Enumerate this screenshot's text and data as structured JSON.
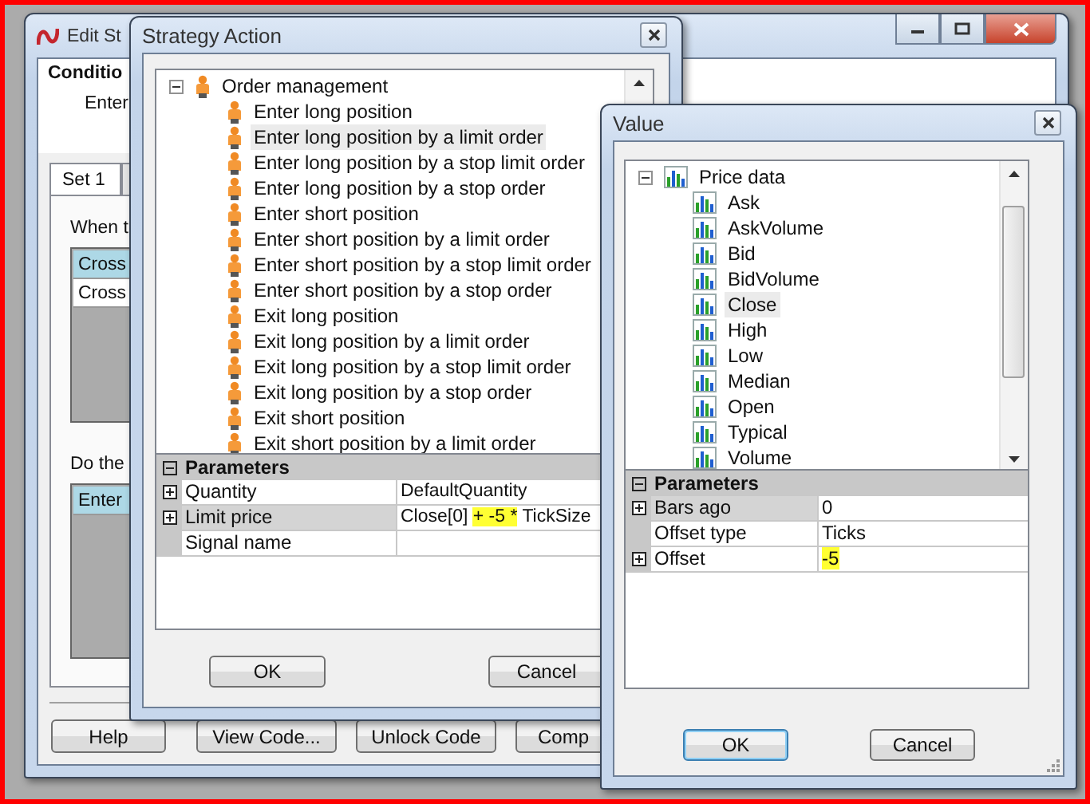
{
  "edit_window": {
    "title": "Edit St",
    "header_title": "Conditio",
    "header_text": "Enter",
    "tabs": [
      {
        "label": "Set 1",
        "selected": true
      }
    ],
    "condition_label": "When t",
    "condition_rows": [
      {
        "text": "Cross",
        "selected": true
      },
      {
        "text": "Cross",
        "selected": false
      }
    ],
    "action_label": "Do the",
    "action_rows": [
      {
        "text": "Enter",
        "selected": true
      }
    ],
    "buttons": [
      "Help",
      "View Code...",
      "Unlock Code",
      "Comp"
    ]
  },
  "strategy_window": {
    "title": "Strategy Action",
    "tree": {
      "label": "Order management",
      "expanded": true,
      "children": [
        {
          "label": "Enter long position",
          "selected": false
        },
        {
          "label": "Enter long position by a limit order",
          "selected": true
        },
        {
          "label": "Enter long position by a stop limit order",
          "selected": false
        },
        {
          "label": "Enter long position by a stop order",
          "selected": false
        },
        {
          "label": "Enter short position",
          "selected": false
        },
        {
          "label": "Enter short position by a limit order",
          "selected": false
        },
        {
          "label": "Enter short position by a stop limit order",
          "selected": false
        },
        {
          "label": "Enter short position by a stop order",
          "selected": false
        },
        {
          "label": "Exit long position",
          "selected": false
        },
        {
          "label": "Exit long position by a limit order",
          "selected": false
        },
        {
          "label": "Exit long position by a stop limit order",
          "selected": false
        },
        {
          "label": "Exit long position by a stop order",
          "selected": false
        },
        {
          "label": "Exit short position",
          "selected": false
        },
        {
          "label": "Exit short position by a limit order",
          "selected": false
        }
      ]
    },
    "parameters": {
      "title": "Parameters",
      "expanded": true,
      "rows": [
        {
          "name": "Quantity",
          "expandable": true,
          "selected": false,
          "value": [
            {
              "text": "DefaultQuantity",
              "highlighted": false
            }
          ]
        },
        {
          "name": "Limit price",
          "expandable": true,
          "selected": true,
          "value": [
            {
              "text": "Close[0] ",
              "highlighted": false
            },
            {
              "text": "+ -5 *",
              "highlighted": true
            },
            {
              "text": " TickSize",
              "highlighted": false
            }
          ]
        },
        {
          "name": "Signal name",
          "expandable": false,
          "selected": false
        }
      ]
    },
    "buttons": [
      {
        "label": "OK",
        "default": false
      },
      {
        "label": "Cancel",
        "default": false
      }
    ]
  },
  "value_window": {
    "title": "Value",
    "tree": {
      "label": "Price data",
      "expanded": true,
      "children": [
        {
          "label": "Ask",
          "selected": false
        },
        {
          "label": "AskVolume",
          "selected": false
        },
        {
          "label": "Bid",
          "selected": false
        },
        {
          "label": "BidVolume",
          "selected": false
        },
        {
          "label": "Close",
          "selected": true
        },
        {
          "label": "High",
          "selected": false
        },
        {
          "label": "Low",
          "selected": false
        },
        {
          "label": "Median",
          "selected": false
        },
        {
          "label": "Open",
          "selected": false
        },
        {
          "label": "Typical",
          "selected": false
        },
        {
          "label": "Volume",
          "selected": false
        }
      ]
    },
    "parameters": {
      "title": "Parameters",
      "expanded": true,
      "rows": [
        {
          "name": "Bars ago",
          "expandable": true,
          "selected": true,
          "value": [
            {
              "text": "0",
              "highlighted": false
            }
          ]
        },
        {
          "name": "Offset type",
          "expandable": false,
          "selected": false,
          "value": [
            {
              "text": "Ticks",
              "highlighted": false
            }
          ]
        },
        {
          "name": "Offset",
          "expandable": true,
          "selected": false,
          "value": [
            {
              "text": "-5",
              "highlighted": true
            }
          ]
        }
      ]
    },
    "buttons": [
      {
        "label": "OK",
        "default": true
      },
      {
        "label": "Cancel",
        "default": false
      }
    ]
  }
}
